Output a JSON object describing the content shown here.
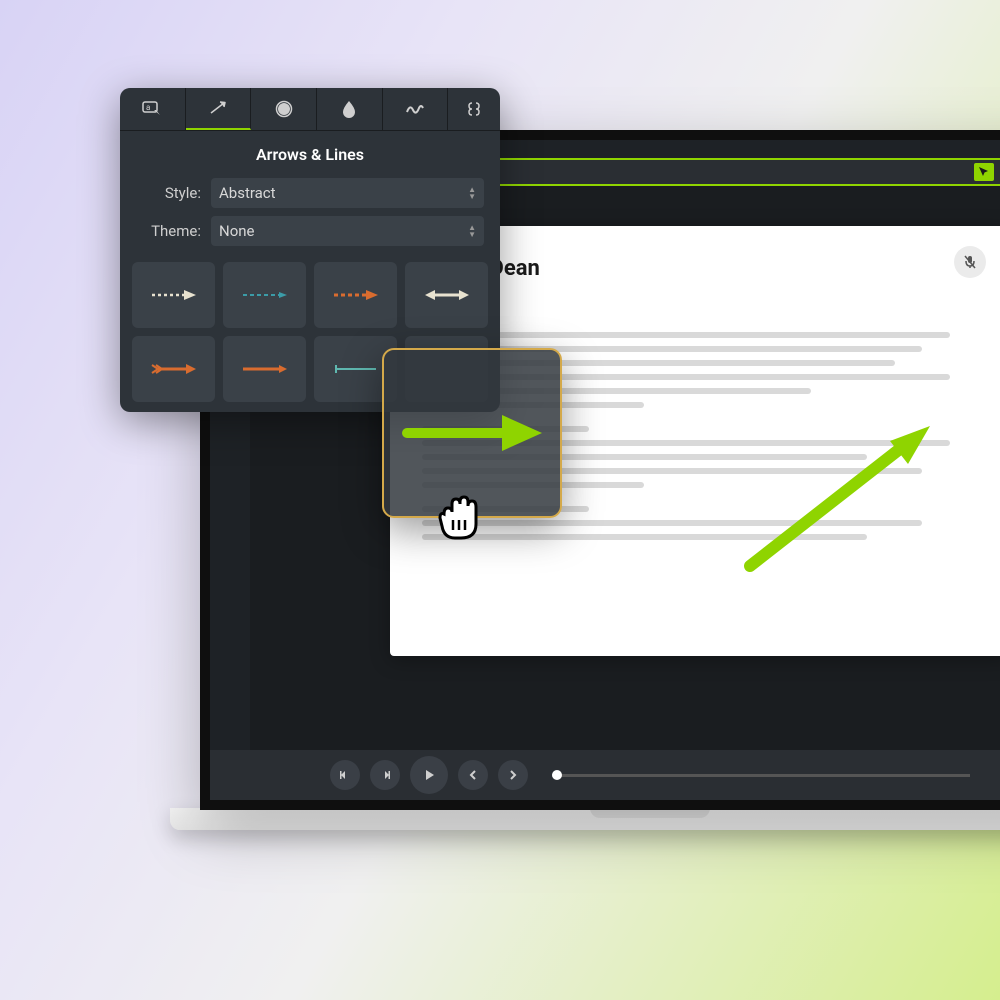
{
  "panel": {
    "title": "Arrows & Lines",
    "style_label": "Style:",
    "style_value": "Abstract",
    "theme_label": "Theme:",
    "theme_value": "None"
  },
  "document": {
    "author": "Renee Dean"
  },
  "colors": {
    "accent": "#8fd400",
    "orange": "#d96c2f",
    "teal": "#3b9ca8"
  }
}
